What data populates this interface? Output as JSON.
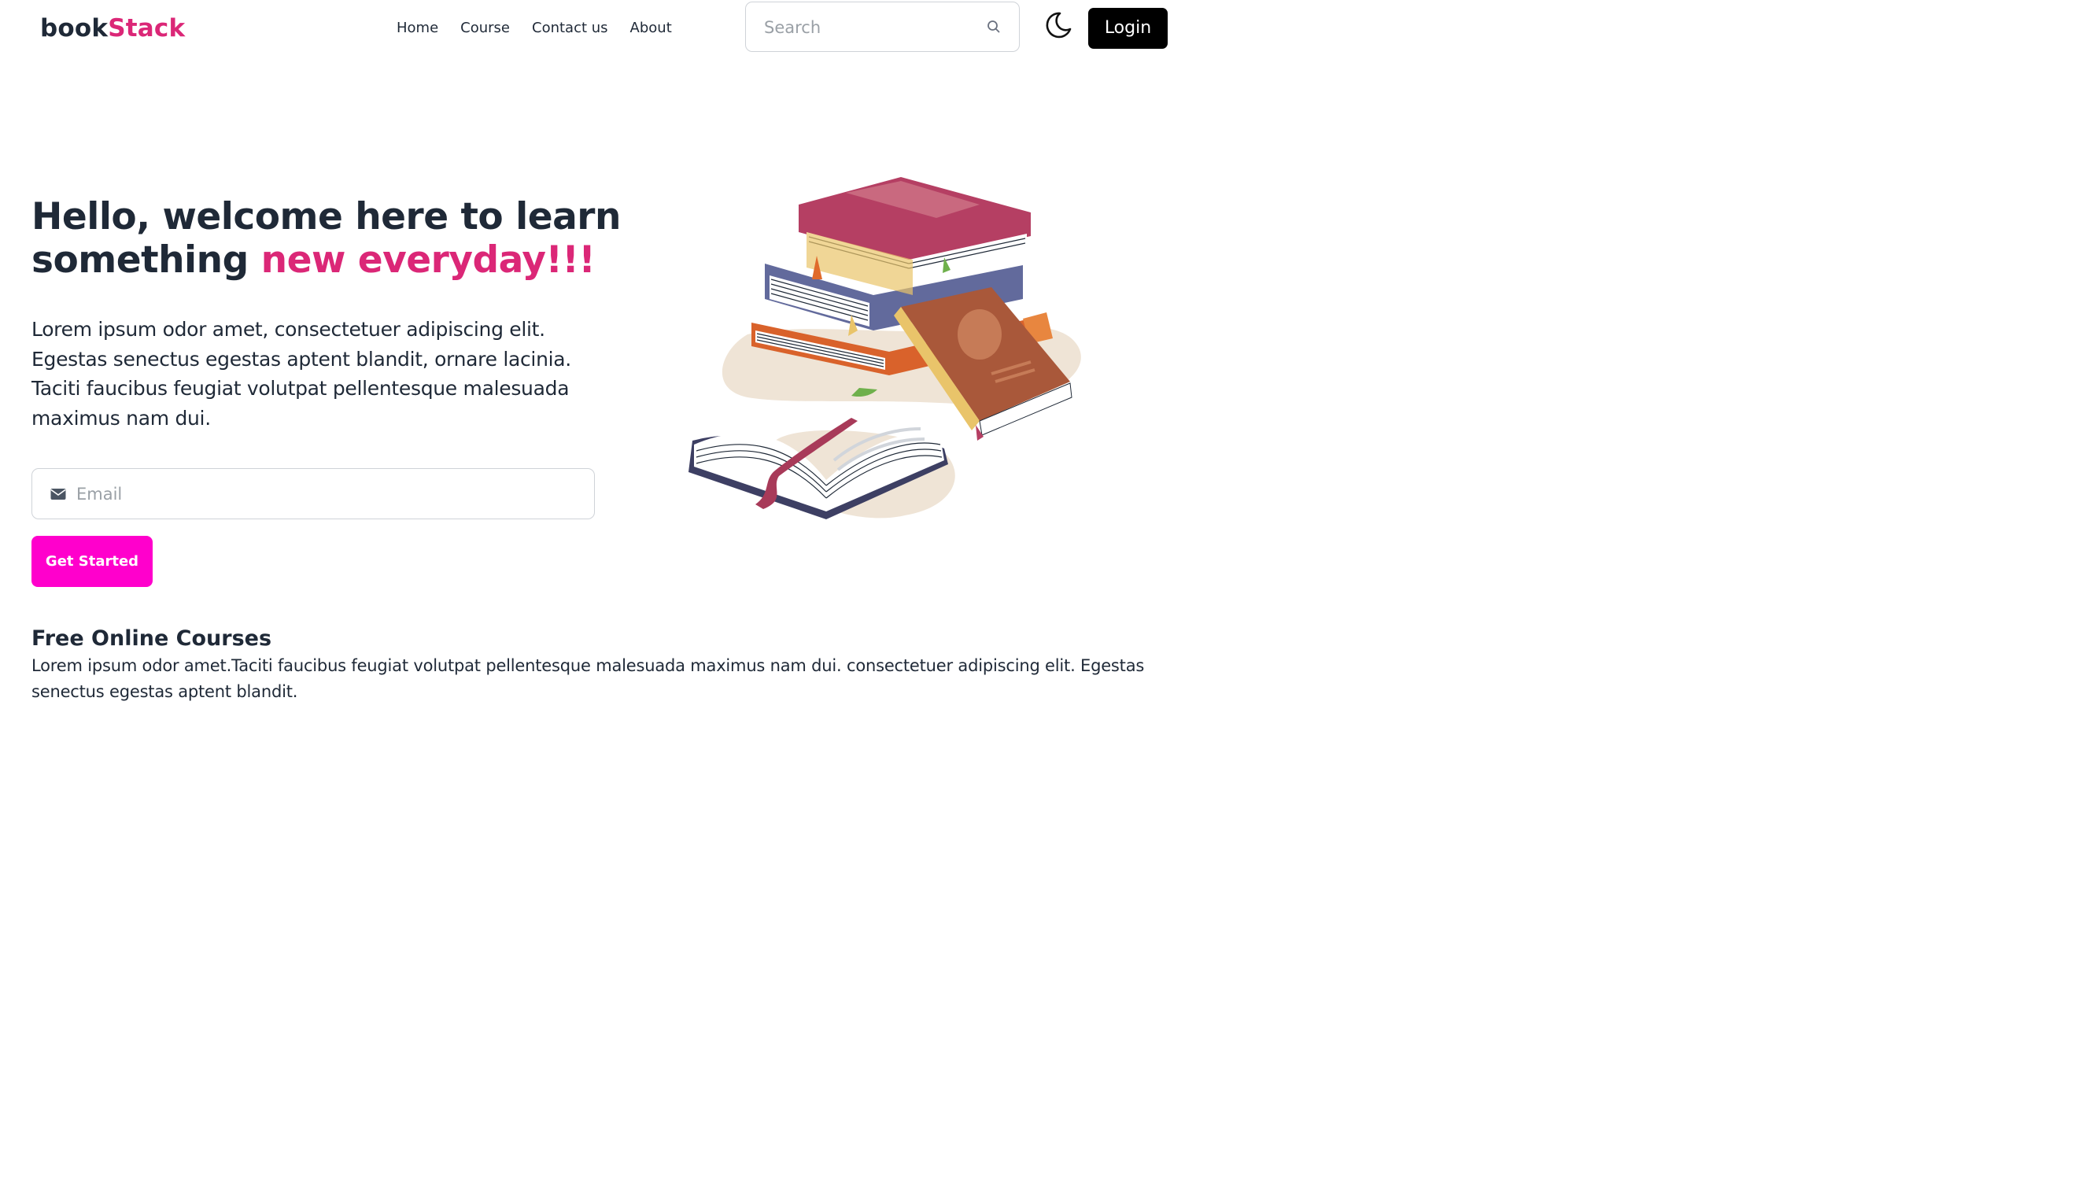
{
  "header": {
    "logo_part1": "book",
    "logo_part2": "Stack",
    "nav": [
      "Home",
      "Course",
      "Contact us",
      "About"
    ],
    "search_placeholder": "Search",
    "theme_toggle_icon": "moon-icon",
    "login_label": "Login"
  },
  "hero": {
    "title_line1": "Hello, welcome here to learn",
    "title_line2_prefix": "something ",
    "title_highlight": "new everyday!!!",
    "paragraph": "Lorem ipsum odor amet, consectetuer adipiscing elit. Egestas senectus egestas aptent blandit, ornare lacinia. Taciti faucibus feugiat volutpat pellentesque malesuada maximus nam dui.",
    "email_placeholder": "Email",
    "email_icon": "mail-icon",
    "cta_label": "Get Started",
    "illustration": "books-stack-illustration"
  },
  "courses": {
    "title": "Free Online Courses",
    "text": "Lorem ipsum odor amet.Taciti faucibus feugiat volutpat pellentesque malesuada maximus nam dui. consectetuer adipiscing elit. Egestas senectus egestas aptent blandit."
  },
  "colors": {
    "brand_pink": "#db2777",
    "cta_magenta": "#ff00cc",
    "text_dark": "#1f2937",
    "login_bg": "#000000"
  }
}
